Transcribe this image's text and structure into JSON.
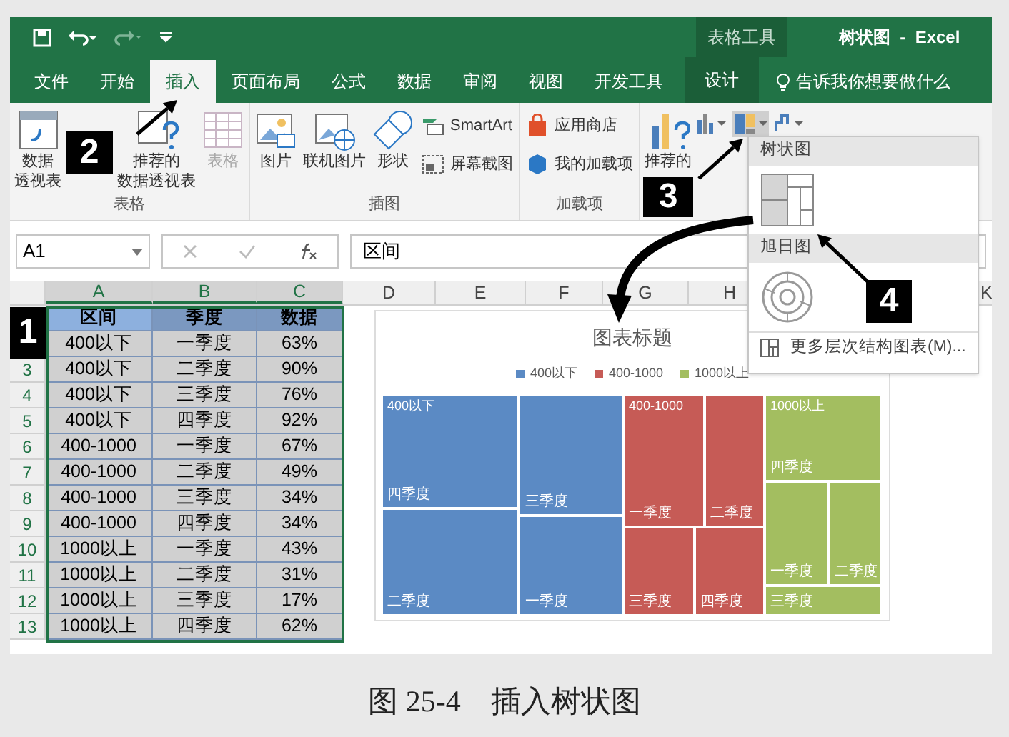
{
  "title_bar": {
    "context_group": "表格工具",
    "title": "树状图  -  Excel"
  },
  "tabs": [
    {
      "label": "文件",
      "selected": false,
      "kind": "normal"
    },
    {
      "label": "开始",
      "selected": false,
      "kind": "normal"
    },
    {
      "label": "插入",
      "selected": true,
      "kind": "normal"
    },
    {
      "label": "页面布局",
      "selected": false,
      "kind": "normal"
    },
    {
      "label": "公式",
      "selected": false,
      "kind": "normal"
    },
    {
      "label": "数据",
      "selected": false,
      "kind": "normal"
    },
    {
      "label": "审阅",
      "selected": false,
      "kind": "normal"
    },
    {
      "label": "视图",
      "selected": false,
      "kind": "normal"
    },
    {
      "label": "开发工具",
      "selected": false,
      "kind": "normal"
    },
    {
      "label": "设计",
      "selected": false,
      "kind": "context"
    }
  ],
  "tell_me": "告诉我你想要做什么",
  "ribbon": [
    {
      "label": "表格",
      "items": [
        {
          "kind": "large",
          "lines": [
            "数据",
            "透视表"
          ],
          "disabled": false
        },
        {
          "kind": "large",
          "lines": [
            "推荐的",
            "数据透视表"
          ],
          "disabled": false
        },
        {
          "kind": "large",
          "lines": [
            "表格"
          ],
          "disabled": true
        }
      ]
    },
    {
      "label": "插图",
      "items": [
        {
          "kind": "large",
          "lines": [
            "图片"
          ],
          "disabled": false
        },
        {
          "kind": "large",
          "lines": [
            "联机图片"
          ],
          "disabled": false
        },
        {
          "kind": "large",
          "lines": [
            "形状"
          ],
          "disabled": false
        },
        {
          "kind": "small",
          "lines": [
            "SmartArt"
          ],
          "disabled": false
        },
        {
          "kind": "small",
          "lines": [
            "屏幕截图"
          ],
          "disabled": false
        }
      ]
    },
    {
      "label": "加载项",
      "items": [
        {
          "kind": "small",
          "lines": [
            "应用商店"
          ],
          "disabled": false
        },
        {
          "kind": "small",
          "lines": [
            "我的加载项"
          ],
          "disabled": false
        }
      ]
    },
    {
      "items": [
        {
          "kind": "large",
          "lines": [
            "推荐的"
          ],
          "disabled": false
        }
      ]
    }
  ],
  "formula_bar": {
    "name_box": "A1",
    "formula": "区间"
  },
  "sheet": {
    "columns": [
      {
        "label": "A",
        "selected": true
      },
      {
        "label": "B",
        "selected": true
      },
      {
        "label": "C",
        "selected": true
      },
      {
        "label": "D",
        "selected": false
      },
      {
        "label": "E",
        "selected": false
      },
      {
        "label": "F",
        "selected": false
      },
      {
        "label": "G",
        "selected": false
      },
      {
        "label": "H",
        "selected": false
      },
      {
        "label": "K",
        "selected": false
      }
    ],
    "rows": [
      {
        "cells": [
          "区间",
          "季度",
          "数据"
        ],
        "kind": "header"
      },
      {
        "cells": [
          "400以下",
          "一季度",
          "63%"
        ],
        "kind": "data"
      },
      {
        "row_number": "3",
        "cells": [
          "400以下",
          "二季度",
          "90%"
        ],
        "kind": "data"
      },
      {
        "row_number": "4",
        "cells": [
          "400以下",
          "三季度",
          "76%"
        ],
        "kind": "data"
      },
      {
        "row_number": "5",
        "cells": [
          "400以下",
          "四季度",
          "92%"
        ],
        "kind": "data"
      },
      {
        "row_number": "6",
        "cells": [
          "400-1000",
          "一季度",
          "67%"
        ],
        "kind": "data"
      },
      {
        "row_number": "7",
        "cells": [
          "400-1000",
          "二季度",
          "49%"
        ],
        "kind": "data"
      },
      {
        "row_number": "8",
        "cells": [
          "400-1000",
          "三季度",
          "34%"
        ],
        "kind": "data"
      },
      {
        "row_number": "9",
        "cells": [
          "400-1000",
          "四季度",
          "34%"
        ],
        "kind": "data"
      },
      {
        "row_number": "10",
        "cells": [
          "1000以上",
          "一季度",
          "43%"
        ],
        "kind": "data"
      },
      {
        "row_number": "11",
        "cells": [
          "1000以上",
          "二季度",
          "31%"
        ],
        "kind": "data"
      },
      {
        "row_number": "12",
        "cells": [
          "1000以上",
          "三季度",
          "17%"
        ],
        "kind": "data"
      },
      {
        "row_number": "13",
        "cells": [
          "1000以上",
          "四季度",
          "62%"
        ],
        "kind": "data"
      }
    ]
  },
  "chart": {
    "title": "图表标题",
    "legend": [
      {
        "label": "400以下",
        "color": "#5b8ac4"
      },
      {
        "label": "400-1000",
        "color": "#c65b56"
      },
      {
        "label": "1000以上",
        "color": "#a3be60"
      }
    ],
    "groups": [
      {
        "label": "400以下",
        "color": "#5b8ac4",
        "leaves": [
          "四季度",
          "二季度",
          "三季度",
          "一季度"
        ]
      },
      {
        "label": "400-1000",
        "color": "#c65b56",
        "leaves": [
          "一季度",
          "二季度",
          "三季度",
          "四季度"
        ]
      },
      {
        "label": "1000以上",
        "color": "#a3be60",
        "leaves": [
          "四季度",
          "一季度",
          "二季度",
          "三季度"
        ]
      }
    ]
  },
  "dropdown": {
    "sections": [
      {
        "heading": "树状图",
        "kind": "treemap"
      },
      {
        "heading": "旭日图",
        "kind": "sunburst"
      }
    ],
    "more": "更多层次结构图表(M)..."
  },
  "callouts": [
    "1",
    "2",
    "3",
    "4"
  ],
  "caption": "图 25-4　插入树状图"
}
